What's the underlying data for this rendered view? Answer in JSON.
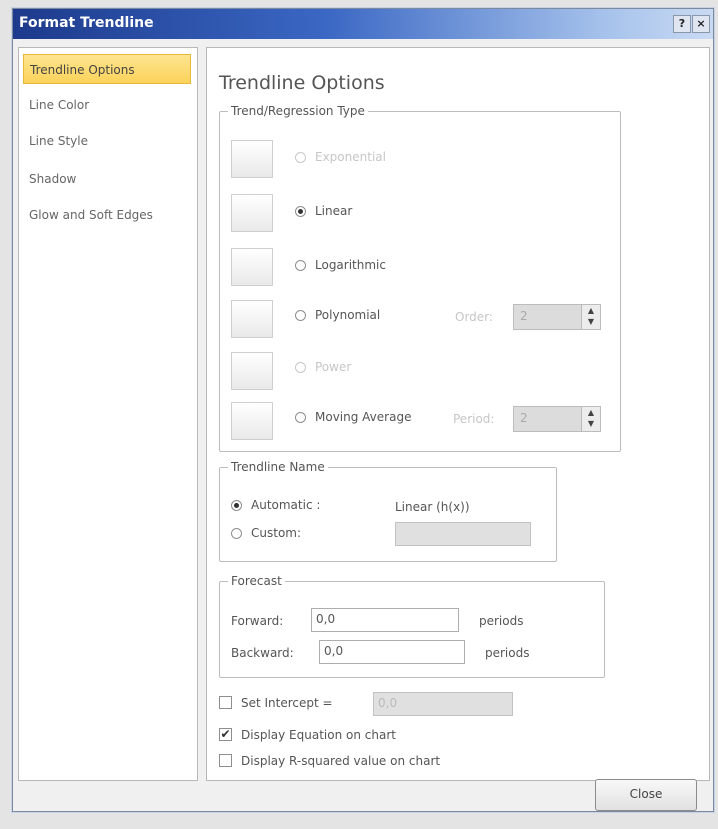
{
  "window": {
    "title": "Format Trendline",
    "help": "?",
    "close": "×"
  },
  "nav": {
    "items": [
      {
        "label": "Trendline Options",
        "selected": true
      },
      {
        "label": "Line Color"
      },
      {
        "label": "Line Style"
      },
      {
        "label": "Shadow"
      },
      {
        "label": "Glow and Soft Edges"
      }
    ]
  },
  "heading": "Trendline Options",
  "regression": {
    "legend": "Trend/Regression Type",
    "options": [
      {
        "label": "Exponential",
        "enabled": false,
        "checked": false
      },
      {
        "label": "Linear",
        "enabled": true,
        "checked": true
      },
      {
        "label": "Logarithmic",
        "enabled": true,
        "checked": false
      },
      {
        "label": "Polynomial",
        "enabled": true,
        "checked": false
      },
      {
        "label": "Power",
        "enabled": false,
        "checked": false
      },
      {
        "label": "Moving Average",
        "enabled": true,
        "checked": false
      }
    ],
    "order_label": "Order:",
    "order_value": "2",
    "period_label": "Period:",
    "period_value": "2"
  },
  "trendline_name": {
    "legend": "Trendline Name",
    "automatic_label": "Automatic :",
    "automatic_value": "Linear (h(x))",
    "custom_label": "Custom:",
    "custom_value": ""
  },
  "forecast": {
    "legend": "Forecast",
    "forward_label": "Forward:",
    "forward_value": "0,0",
    "forward_unit": "periods",
    "backward_label": "Backward:",
    "backward_value": "0,0",
    "backward_unit": "periods"
  },
  "set_intercept": {
    "label": "Set Intercept =",
    "value": "0,0",
    "checked": false
  },
  "display_equation": {
    "label": "Display Equation on chart",
    "checked": true
  },
  "display_r2": {
    "label": "Display R-squared value on chart",
    "checked": false
  },
  "close_button": "Close"
}
